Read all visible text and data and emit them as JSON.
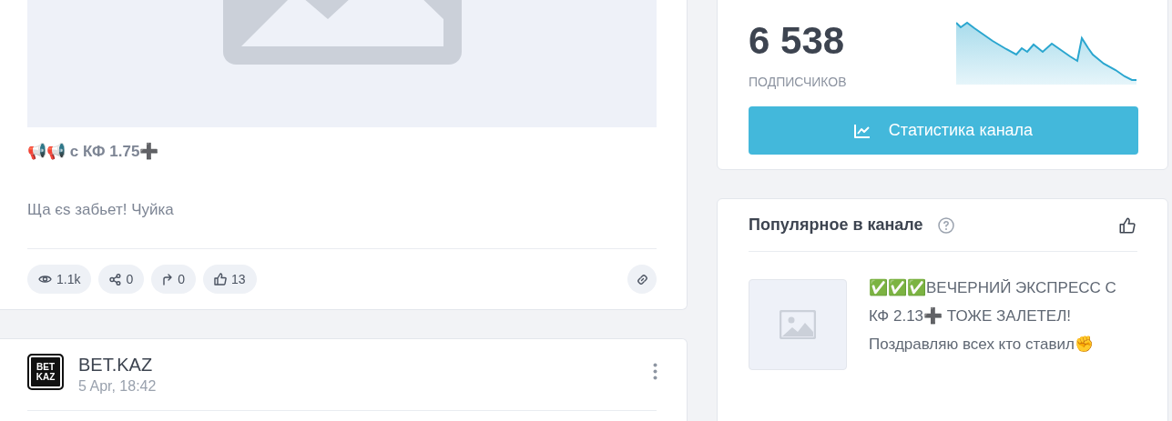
{
  "post": {
    "title": "📢📢 с КФ 1.75➕",
    "text": "Ща єs забьет! Чуйка",
    "stats": [
      {
        "kind": "views",
        "value": "1.1k"
      },
      {
        "kind": "shares",
        "value": "0"
      },
      {
        "kind": "forwards",
        "value": "0"
      },
      {
        "kind": "likes",
        "value": "13"
      }
    ]
  },
  "next_post": {
    "avatar_text": [
      "BET",
      "KAZ"
    ],
    "channel": "BET.KAZ",
    "time": "5 Apr, 18:42"
  },
  "subscribers": {
    "count": "6 538",
    "label": "ПОДПИСЧИКОВ",
    "button": "Статистика канала"
  },
  "popular": {
    "title": "Популярное в канале",
    "items": [
      {
        "text": "✅✅✅ВЕЧЕРНИЙ ЭКСПРЕСС С КФ 2.13➕ ТОЖЕ ЗАЛЕТЕЛ! Поздравляю всех кто ставил✊"
      }
    ]
  }
}
